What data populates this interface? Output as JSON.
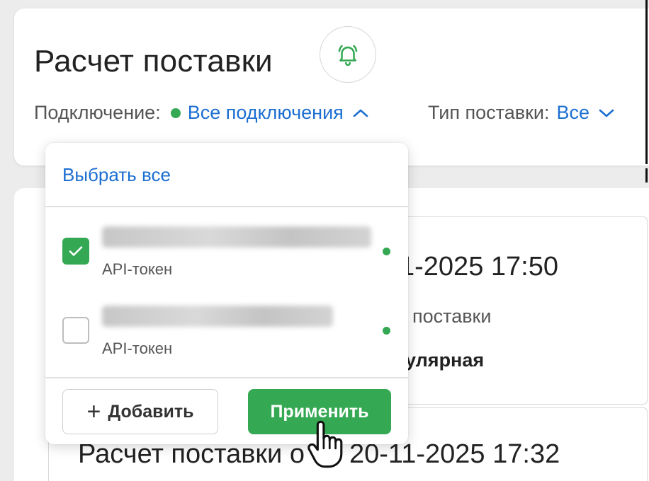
{
  "header": {
    "title": "Расчет поставки",
    "bell_icon": "bell-icon",
    "connection_label": "Подключение:",
    "connection_value": "Все подключения",
    "delivery_type_label": "Тип поставки:",
    "delivery_type_value": "Все"
  },
  "colors": {
    "accent_green": "#34a853",
    "link_blue": "#1d6fd1"
  },
  "dropdown": {
    "select_all": "Выбрать все",
    "items": [
      {
        "type": "API-токен",
        "checked": true,
        "status": "active"
      },
      {
        "type": "API-токен",
        "checked": false,
        "status": "active"
      }
    ],
    "add_label": "Добавить",
    "apply_label": "Применить"
  },
  "cards": [
    {
      "title_visible": "1-2025 17:50",
      "subtitle_visible": "поставки",
      "strong_visible": "улярная"
    },
    {
      "title_left": "Расчет поставки о",
      "title_right": "20-11-2025 17:32"
    }
  ]
}
